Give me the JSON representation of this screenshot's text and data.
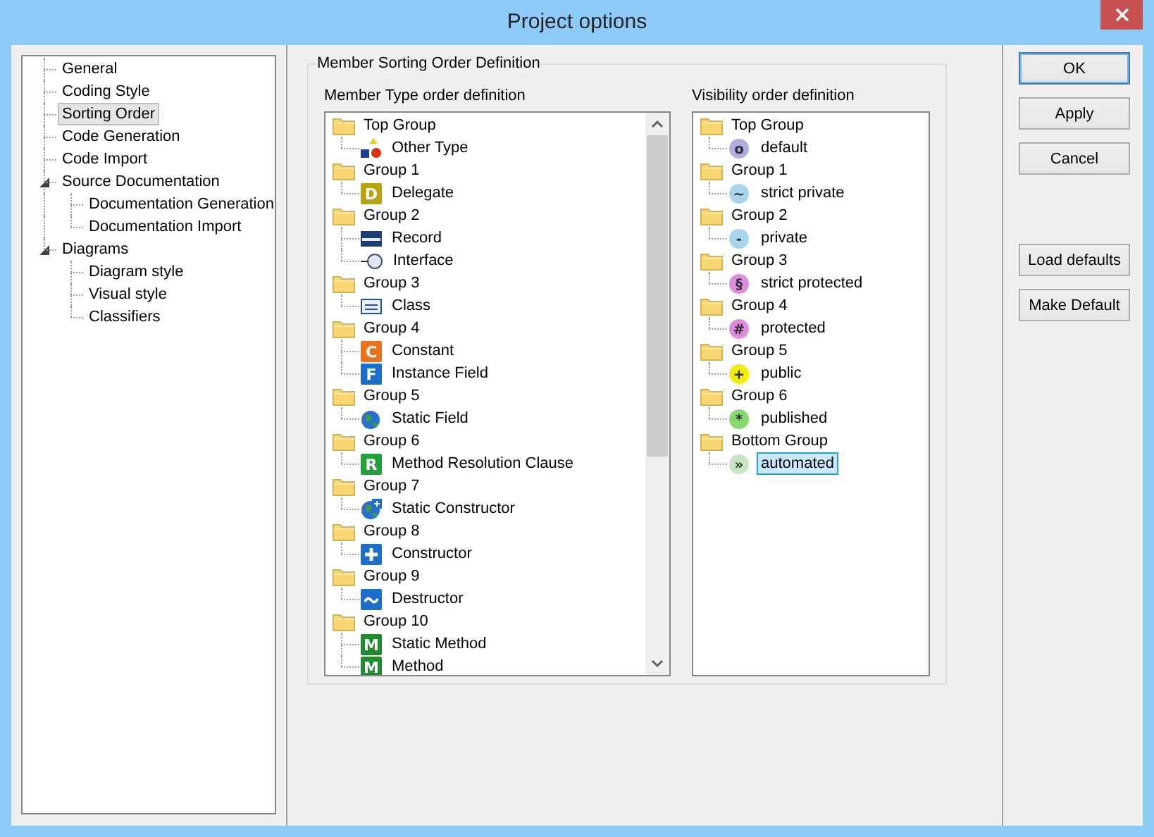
{
  "window": {
    "title": "Project options"
  },
  "sidebar": {
    "items": [
      {
        "label": "General",
        "selected": false
      },
      {
        "label": "Coding Style",
        "selected": false
      },
      {
        "label": "Sorting Order",
        "selected": true
      },
      {
        "label": "Code Generation",
        "selected": false
      },
      {
        "label": "Code Import",
        "selected": false
      },
      {
        "label": "Source Documentation",
        "selected": false,
        "expanded": true,
        "children": [
          {
            "label": "Documentation Generation",
            "selected": false
          },
          {
            "label": "Documentation Import",
            "selected": false
          }
        ]
      },
      {
        "label": "Diagrams",
        "selected": false,
        "expanded": true,
        "children": [
          {
            "label": "Diagram style",
            "selected": false
          },
          {
            "label": "Visual style",
            "selected": false
          },
          {
            "label": "Classifiers",
            "selected": false
          }
        ]
      }
    ]
  },
  "group_box": {
    "title": "Member Sorting Order Definition",
    "member_type_list": {
      "label": "Member Type order definition",
      "groups": [
        {
          "label": "Top Group",
          "selected": false,
          "children": [
            {
              "label": "Other Type",
              "kind": "shapes",
              "selected": false
            }
          ]
        },
        {
          "label": "Group 1",
          "selected": false,
          "children": [
            {
              "label": "Delegate",
              "kind": "letter",
              "badge": "D",
              "color": "#b7a30c",
              "selected": false
            }
          ]
        },
        {
          "label": "Group 2",
          "selected": false,
          "children": [
            {
              "label": "Record",
              "kind": "record",
              "selected": false
            },
            {
              "label": "Interface",
              "kind": "interface",
              "selected": false
            }
          ]
        },
        {
          "label": "Group 3",
          "selected": false,
          "children": [
            {
              "label": "Class",
              "kind": "class",
              "selected": false
            }
          ]
        },
        {
          "label": "Group 4",
          "selected": false,
          "children": [
            {
              "label": "Constant",
              "kind": "letter",
              "badge": "C",
              "color": "#e8731c",
              "selected": false
            },
            {
              "label": "Instance Field",
              "kind": "letter",
              "badge": "F",
              "color": "#1b6fcb",
              "selected": false
            }
          ]
        },
        {
          "label": "Group 5",
          "selected": false,
          "children": [
            {
              "label": "Static Field",
              "kind": "globe",
              "selected": false
            }
          ]
        },
        {
          "label": "Group 6",
          "selected": false,
          "children": [
            {
              "label": "Method Resolution Clause",
              "kind": "letter",
              "badge": "R",
              "color": "#22a03a",
              "selected": false
            }
          ]
        },
        {
          "label": "Group 7",
          "selected": false,
          "children": [
            {
              "label": "Static Constructor",
              "kind": "globe-plus",
              "selected": false
            }
          ]
        },
        {
          "label": "Group 8",
          "selected": false,
          "children": [
            {
              "label": "Constructor",
              "kind": "plus",
              "selected": false
            }
          ]
        },
        {
          "label": "Group 9",
          "selected": false,
          "children": [
            {
              "label": "Destructor",
              "kind": "wave",
              "selected": false
            }
          ]
        },
        {
          "label": "Group 10",
          "selected": false,
          "children": [
            {
              "label": "Static Method",
              "kind": "letter",
              "badge": "M",
              "color": "#1f8a2e",
              "selected": false
            },
            {
              "label": "Method",
              "kind": "letter",
              "badge": "M",
              "color": "#1f8a2e",
              "selected": false
            }
          ]
        }
      ]
    },
    "visibility_list": {
      "label": "Visibility order definition",
      "groups": [
        {
          "label": "Top Group",
          "selected": false,
          "children": [
            {
              "label": "default",
              "symbol": "o",
              "color": "#aeaee0",
              "selected": false
            }
          ]
        },
        {
          "label": "Group 1",
          "selected": false,
          "children": [
            {
              "label": "strict private",
              "symbol": "~",
              "color": "#a8d4ee",
              "selected": false
            }
          ]
        },
        {
          "label": "Group 2",
          "selected": false,
          "children": [
            {
              "label": "private",
              "symbol": "-",
              "color": "#a8d4ee",
              "selected": false
            }
          ]
        },
        {
          "label": "Group 3",
          "selected": false,
          "children": [
            {
              "label": "strict protected",
              "symbol": "§",
              "color": "#e08ae0",
              "selected": false
            }
          ]
        },
        {
          "label": "Group 4",
          "selected": false,
          "children": [
            {
              "label": "protected",
              "symbol": "#",
              "color": "#e08ae0",
              "selected": false
            }
          ]
        },
        {
          "label": "Group 5",
          "selected": false,
          "children": [
            {
              "label": "public",
              "symbol": "+",
              "color": "#f0f000",
              "selected": false
            }
          ]
        },
        {
          "label": "Group 6",
          "selected": false,
          "children": [
            {
              "label": "published",
              "symbol": "*",
              "color": "#88d870",
              "selected": false
            }
          ]
        },
        {
          "label": "Bottom Group",
          "selected": false,
          "children": [
            {
              "label": "automated",
              "symbol": "»",
              "color": "#c8e4c0",
              "selected": true
            }
          ]
        }
      ]
    }
  },
  "dialog_buttons": [
    {
      "label": "OK",
      "default": true
    },
    {
      "label": "Apply",
      "default": false
    },
    {
      "label": "Cancel",
      "default": false
    }
  ],
  "defaults_buttons": [
    {
      "label": "Load defaults",
      "default": false
    },
    {
      "label": "Make Default",
      "default": false
    }
  ]
}
